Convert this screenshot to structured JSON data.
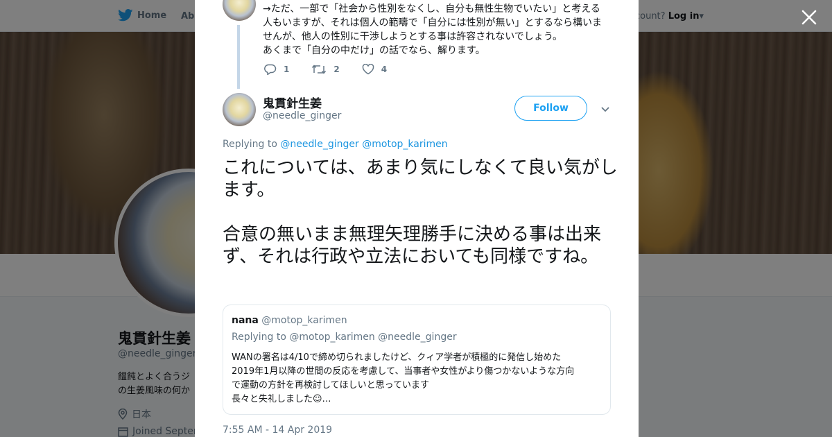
{
  "nav": {
    "home": "Home",
    "about": "Abo",
    "have_account": "ccount?",
    "login": "Log in"
  },
  "profile": {
    "name": "鬼貫針生姜",
    "handle": "@needle_ginger",
    "bio_line1": "饂飩とよく合うジ",
    "bio_line2": "の生姜風味の何か",
    "location": "日本",
    "joined": "Joined Septen"
  },
  "previous_tweet": {
    "lines": [
      "→ただ、一部で「社会から性別をなくし、自分も無性生物でいたい」と考える",
      "人もいますが、それは個人の範疇で「自分には性別が無い」とするなら構いま",
      "せんが、他人の性別に干渉しようとする事は許容されないでしょう。",
      "あくまで「自分の中だけ」の話でなら、解ります。"
    ],
    "replies": "1",
    "retweets": "2",
    "likes": "4"
  },
  "tweet": {
    "author_name": "鬼貫針生姜",
    "author_handle": "@needle_ginger",
    "follow_label": "Follow",
    "replying_prefix": "Replying to",
    "replying_to_1": "@needle_ginger",
    "replying_to_2": "@motop_karimen",
    "paragraph1": "これについては、あまり気にしなくて良い気がします。",
    "paragraph2": "合意の無いまま無理矢理勝手に決める事は出来ず、それは行政や立法においても同様ですね。",
    "timestamp": "7:55 AM - 14 Apr 2019"
  },
  "quoted_tweet": {
    "name": "nana",
    "handle": "@motop_karimen",
    "replying": "Replying to @motop_karimen @needle_ginger",
    "lines": [
      "WANの署名は4/10で締め切られましたけど、クィア学者が積極的に発信し始めた",
      "2019年1月以降の世間の反応を考慮して、当事者や女性がより傷つかないような方向",
      "で運動の方針を再検討してほしいと思っています",
      "長々と失礼しました☺…"
    ]
  },
  "colors": {
    "accent": "#1da1f2",
    "link": "#1b95e0",
    "secondary_text": "#657786",
    "primary_text": "#14171a"
  },
  "icons": [
    "twitter-bird-icon",
    "close-icon",
    "reply-icon",
    "retweet-icon",
    "like-icon",
    "chevron-down-icon",
    "location-icon",
    "calendar-icon"
  ]
}
